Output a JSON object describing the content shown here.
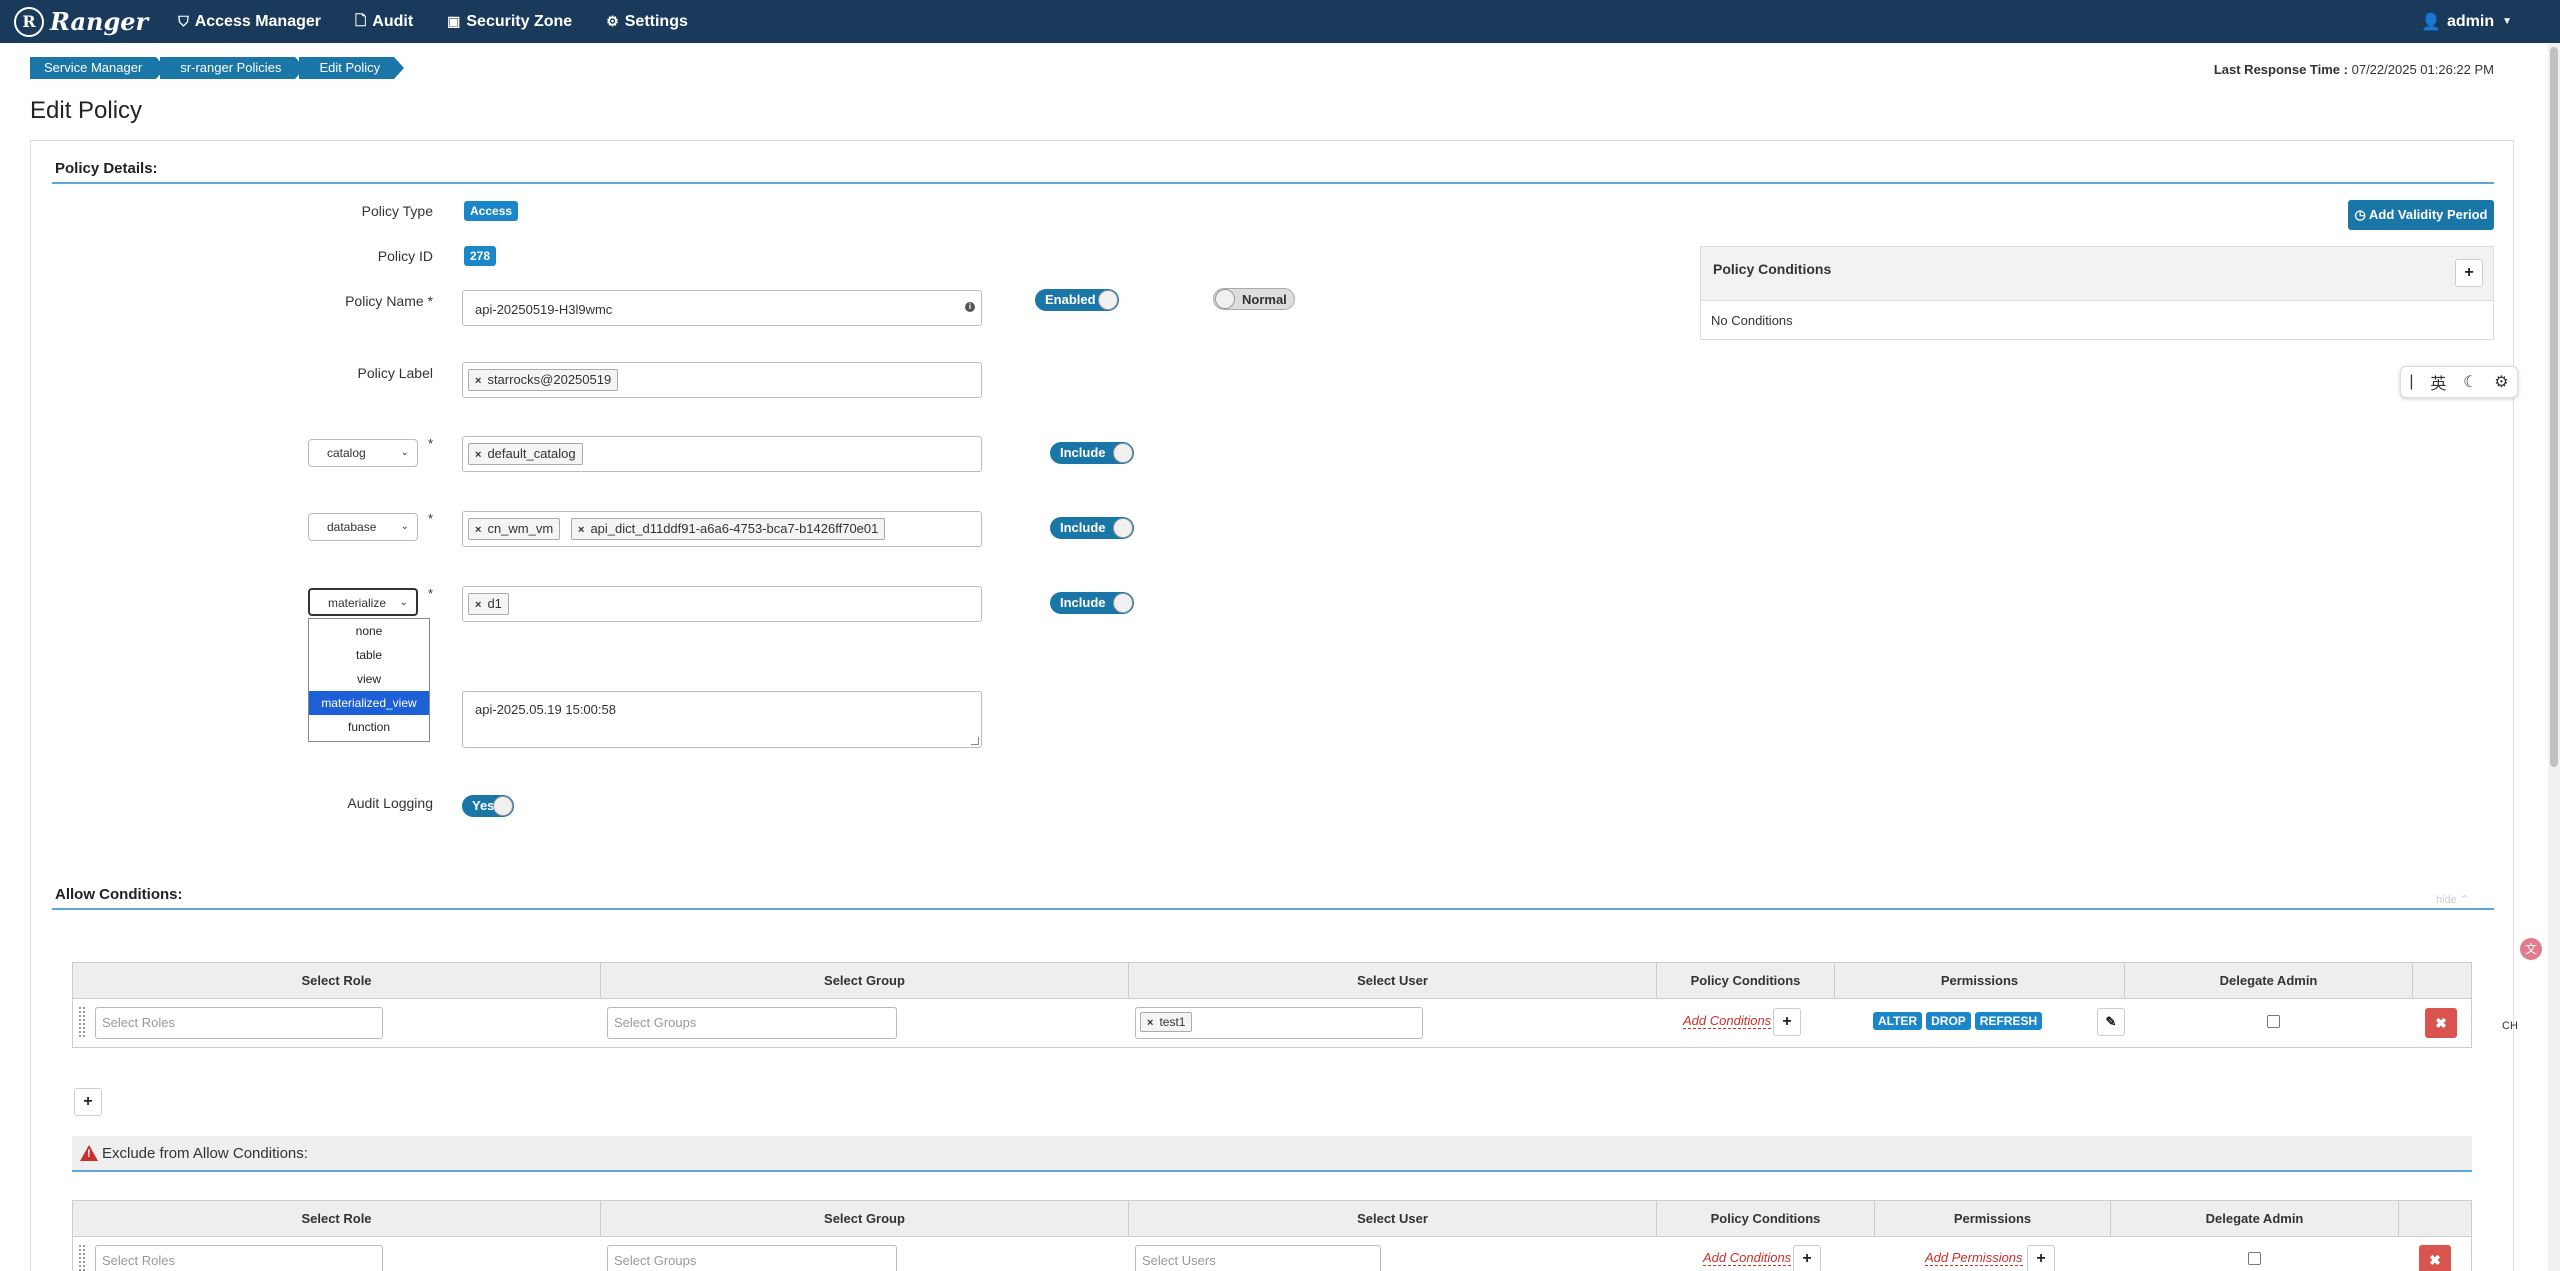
{
  "navbar": {
    "brand_initial": "R",
    "brand": "Ranger",
    "items": [
      {
        "label": "Access Manager",
        "icon": "shield-icon"
      },
      {
        "label": "Audit",
        "icon": "file-icon"
      },
      {
        "label": "Security Zone",
        "icon": "zone-icon"
      },
      {
        "label": "Settings",
        "icon": "gear-icon"
      }
    ],
    "user": "admin"
  },
  "breadcrumb": [
    "Service Manager",
    "sr-ranger Policies",
    "Edit Policy"
  ],
  "response_time": {
    "label": "Last Response Time :",
    "value": "07/22/2025 01:26:22 PM"
  },
  "page_title": "Edit Policy",
  "policy_details": {
    "title": "Policy Details:",
    "policy_type_label": "Policy Type",
    "policy_type": "Access",
    "policy_id_label": "Policy ID",
    "policy_id": "278",
    "policy_name_label": "Policy Name *",
    "policy_name": "api-20250519-H3l9wmc",
    "enabled_toggle": "Enabled",
    "normal_toggle": "Normal",
    "policy_label_label": "Policy Label",
    "policy_labels": [
      "starrocks@20250519"
    ],
    "resources": [
      {
        "type": "catalog",
        "values": [
          "default_catalog"
        ],
        "include": "Include"
      },
      {
        "type": "database",
        "values": [
          "cn_wm_vm",
          "api_dict_d11ddf91-a6a6-4753-bca7-b1426ff70e01"
        ],
        "include": "Include"
      },
      {
        "type": "materialize",
        "values": [
          "d1"
        ],
        "include": "Include"
      }
    ],
    "required_mark": "*",
    "dropdown_options": [
      "none",
      "table",
      "view",
      "materialized_view",
      "function"
    ],
    "dropdown_selected": "materialized_view",
    "description": "api-2025.05.19 15:00:58",
    "audit_logging_label": "Audit Logging",
    "audit_logging": "Yes",
    "add_validity_period": "Add Validity Period",
    "policy_conditions_title": "Policy Conditions",
    "no_conditions": "No Conditions"
  },
  "allow_conditions": {
    "title": "Allow Conditions:",
    "hide_label": "hide ⌃",
    "headers": [
      "Select Role",
      "Select Group",
      "Select User",
      "Policy Conditions",
      "Permissions",
      "Delegate Admin"
    ],
    "row": {
      "roles_placeholder": "Select Roles",
      "groups_placeholder": "Select Groups",
      "users": [
        "test1"
      ],
      "add_conditions": "Add Conditions",
      "permissions": [
        "ALTER",
        "DROP",
        "REFRESH"
      ],
      "delegate_admin": false
    }
  },
  "exclude_conditions": {
    "title": "Exclude from Allow Conditions:",
    "headers": [
      "Select Role",
      "Select Group",
      "Select User",
      "Policy Conditions",
      "Permissions",
      "Delegate Admin"
    ],
    "row": {
      "roles_placeholder": "Select Roles",
      "groups_placeholder": "Select Groups",
      "users_placeholder": "Select Users",
      "add_conditions": "Add Conditions",
      "add_permissions": "Add Permissions",
      "delegate_admin": false
    }
  },
  "ime_toolbar": {
    "lang": "英"
  },
  "side_text": "CH",
  "colors": {
    "navbar": "#1a3a5c",
    "accent": "#1b76a8",
    "badge": "#1b86c8",
    "danger": "#d9534f"
  }
}
